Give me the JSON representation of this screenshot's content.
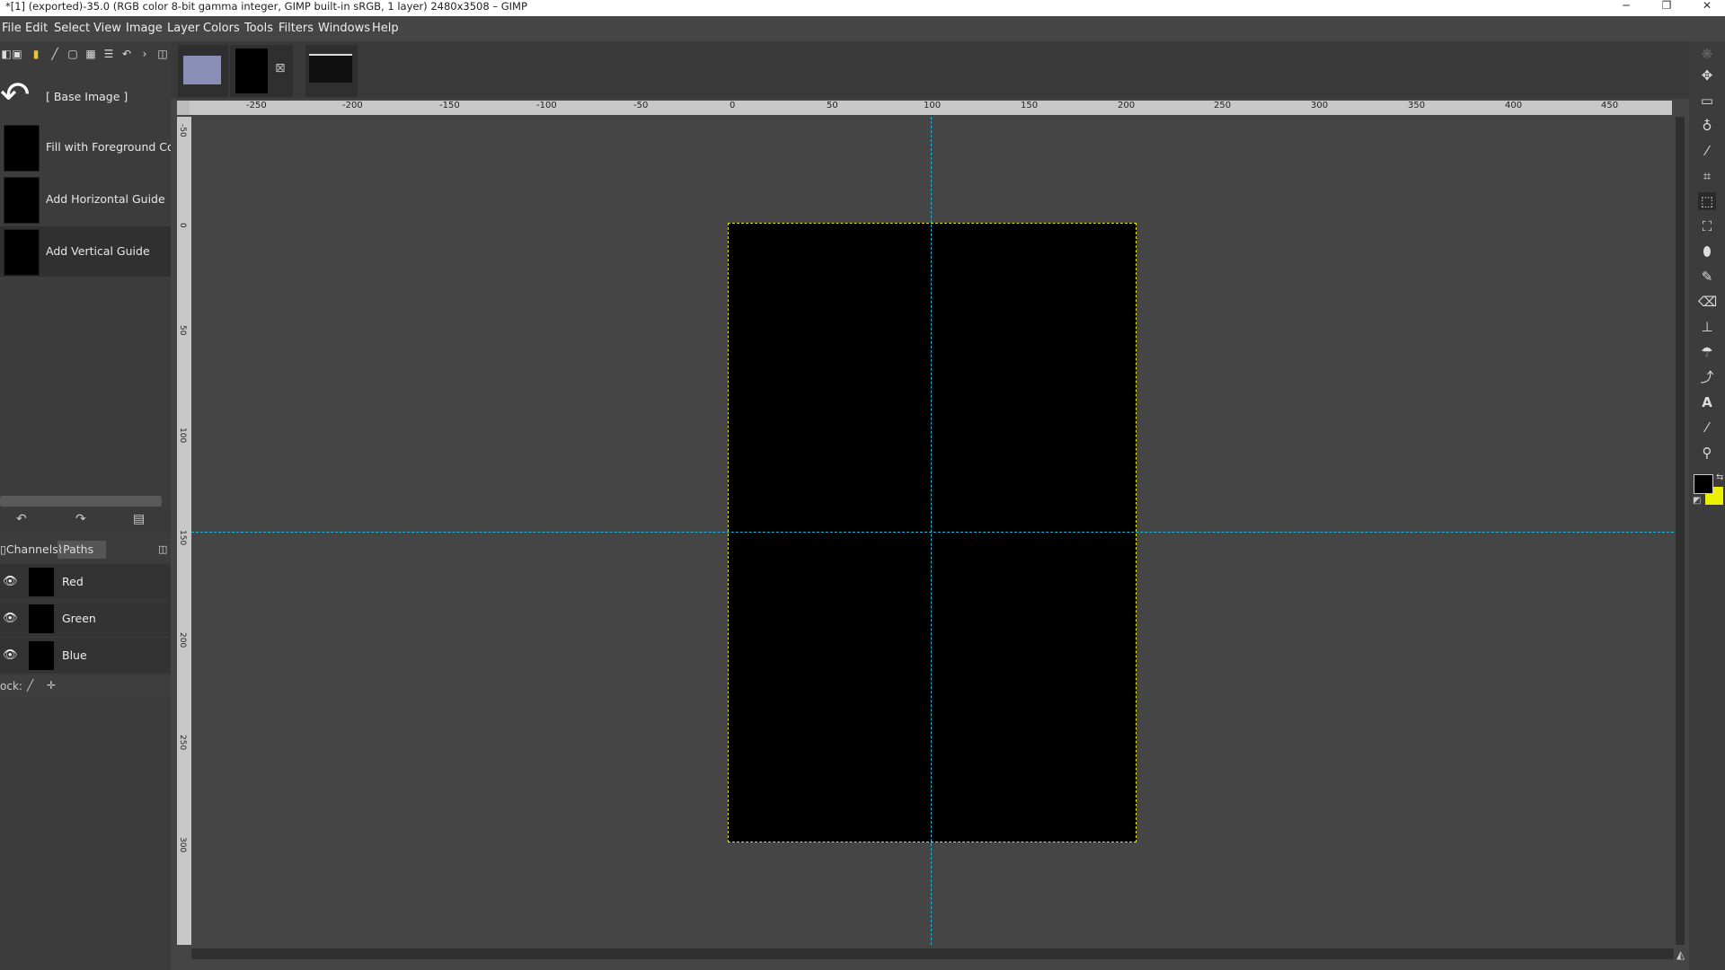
{
  "window": {
    "title": "*[1] (exported)-35.0 (RGB color 8-bit gamma integer, GIMP built-in sRGB, 1 layer) 2480x3508 – GIMP",
    "min_glyph": "─",
    "max_glyph": "❐",
    "close_glyph": "✕"
  },
  "menu": [
    "File",
    "Edit",
    "Select",
    "View",
    "Image",
    "Layer",
    "Colors",
    "Tools",
    "Filters",
    "Windows",
    "Help"
  ],
  "history": {
    "items": [
      {
        "label": "[ Base Image ]"
      },
      {
        "label": "Fill with Foreground Color"
      },
      {
        "label": "Add Horizontal Guide"
      },
      {
        "label": "Add Vertical Guide"
      }
    ]
  },
  "dock_tabs": {
    "channels": "Channels",
    "paths": "Paths"
  },
  "channels": [
    {
      "label": "Red"
    },
    {
      "label": "Green"
    },
    {
      "label": "Blue"
    }
  ],
  "lock": {
    "label": "ock:"
  },
  "ruler": {
    "h_labels": [
      "-250",
      "-200",
      "-150",
      "-100",
      "-50",
      "0",
      "50",
      "100",
      "150",
      "200",
      "250",
      "300",
      "350",
      "400",
      "450"
    ],
    "v_labels": [
      "-50",
      "0",
      "50",
      "100",
      "150",
      "200",
      "250",
      "300"
    ]
  },
  "colors": {
    "fg": "#000000",
    "bg": "#ecf000",
    "guide": "#1fb3d8",
    "selection": "#e3e300"
  }
}
